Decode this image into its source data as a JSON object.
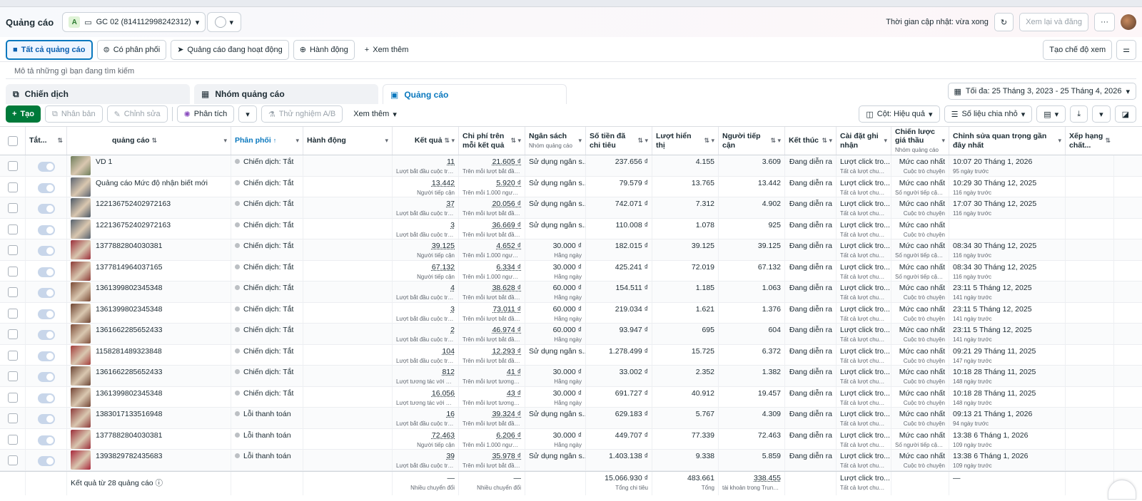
{
  "header": {
    "title": "Quảng cáo",
    "account_badge": "A",
    "account_name": "GC 02 (814112998242312)",
    "last_updated": "Thời gian cập nhật: vừa xong",
    "review_publish": "Xem lại và đăng",
    "more": "···"
  },
  "filters": {
    "all_ads": "Tất cả quảng cáo",
    "has_delivery": "Có phân phối",
    "active_ads": "Quảng cáo đang hoạt động",
    "actions": "Hành động",
    "see_more": "Xem thêm",
    "custom_view": "Tạo chế độ xem"
  },
  "search": {
    "placeholder": "Mô tả những gì bạn đang tìm kiếm"
  },
  "tabs": {
    "campaigns": "Chiến dịch",
    "adsets": "Nhóm quảng cáo",
    "ads": "Quảng cáo"
  },
  "date_range": "Tối đa: 25 Tháng 3, 2023 - 25 Tháng 4, 2026",
  "toolbar": {
    "create": "Tạo",
    "duplicate": "Nhân bản",
    "edit": "Chỉnh sửa",
    "analyze": "Phân tích",
    "ab_test": "Thử nghiệm A/B",
    "see_more": "Xem thêm",
    "columns": "Cột: Hiệu quả",
    "breakdown": "Số liệu chia nhỏ"
  },
  "columns": {
    "onoff": "Tắt...",
    "ad": "quảng cáo",
    "delivery": "Phân phối",
    "actions": "Hành động",
    "results": "Kết quả",
    "cost": "Chi phí trên mỗi kết quả",
    "budget": "Ngân sách",
    "budget_sub": "Nhóm quảng cáo",
    "spent": "Số tiền đã chi tiêu",
    "impressions": "Lượt hiển thị",
    "reach": "Người tiếp cận",
    "ends": "Kết thúc",
    "attribution": "Cài đặt ghi nhận",
    "bid": "Chiến lược giá thầu",
    "bid_sub": "Nhóm quảng cáo",
    "edited": "Chỉnh sửa quan trọng gần đây nhất",
    "rank": "Xếp hạng chất..."
  },
  "rows": [
    {
      "name": "VD 1",
      "delivery": "Chiến dịch: Tắt",
      "result": "11",
      "result_sub": "Lượt bắt đầu cuộc trò...",
      "cost": "21.605 ₫",
      "cost_sub": "Trên mỗi lượt bắt đầu...",
      "budget": "Sử dụng ngân s...",
      "budget_sub": "",
      "spent": "237.656 ₫",
      "impr": "4.155",
      "reach": "3.609",
      "ends": "Đang diễn ra",
      "attr": "Lượt click tro...",
      "attr_sub": "Tất cả lượt chuyển...",
      "bid": "Mức cao nhất",
      "bid_sub": "Cuộc trò chuyện",
      "edit": "10:07 20 Tháng 1, 2026",
      "edit_sub": "95 ngày trước",
      "thumb": "#6f7e5c"
    },
    {
      "name": "Quảng cáo Mức độ nhận biết mới",
      "delivery": "Chiến dịch: Tắt",
      "result": "13.442",
      "result_sub": "Người tiếp cận",
      "cost": "5.920 ₫",
      "cost_sub": "Trên mỗi 1.000 người...",
      "budget": "Sử dụng ngân s...",
      "budget_sub": "",
      "spent": "79.579 ₫",
      "impr": "13.765",
      "reach": "13.442",
      "ends": "Đang diễn ra",
      "attr": "Lượt click tro...",
      "attr_sub": "Tất cả lượt chuyển...",
      "bid": "Mức cao nhất",
      "bid_sub": "Số người tiếp cận h...",
      "edit": "10:29 30 Tháng 12, 2025",
      "edit_sub": "116 ngày trước",
      "thumb": "#5c6470"
    },
    {
      "name": "122136752402972163",
      "delivery": "Chiến dịch: Tắt",
      "result": "37",
      "result_sub": "Lượt bắt đầu cuộc trò...",
      "cost": "20.056 ₫",
      "cost_sub": "Trên mỗi lượt bắt đầu...",
      "budget": "Sử dụng ngân s...",
      "budget_sub": "",
      "spent": "742.071 ₫",
      "impr": "7.312",
      "reach": "4.902",
      "ends": "Đang diễn ra",
      "attr": "Lượt click tro...",
      "attr_sub": "Tất cả lượt chuyển...",
      "bid": "Mức cao nhất",
      "bid_sub": "Cuộc trò chuyện",
      "edit": "17:07 30 Tháng 12, 2025",
      "edit_sub": "116 ngày trước",
      "thumb": "#4e5a66"
    },
    {
      "name": "122136752402972163",
      "delivery": "Chiến dịch: Tắt",
      "result": "3",
      "result_sub": "Lượt bắt đầu cuộc trò...",
      "cost": "36.669 ₫",
      "cost_sub": "Trên mỗi lượt bắt đầu...",
      "budget": "Sử dụng ngân s...",
      "budget_sub": "",
      "spent": "110.008 ₫",
      "impr": "1.078",
      "reach": "925",
      "ends": "Đang diễn ra",
      "attr": "Lượt click tro...",
      "attr_sub": "Tất cả lượt chuyển...",
      "bid": "Mức cao nhất",
      "bid_sub": "Cuộc trò chuyện",
      "edit": "",
      "edit_sub": "",
      "thumb": "#56616d"
    },
    {
      "name": "1377882804030381",
      "delivery": "Chiến dịch: Tắt",
      "result": "39.125",
      "result_sub": "Người tiếp cận",
      "cost": "4.652 ₫",
      "cost_sub": "Trên mỗi 1.000 người...",
      "budget": "30.000 ₫",
      "budget_sub": "Hằng ngày",
      "spent": "182.015 ₫",
      "impr": "39.125",
      "reach": "39.125",
      "ends": "Đang diễn ra",
      "attr": "Lượt click tro...",
      "attr_sub": "Tất cả lượt chuyển...",
      "bid": "Mức cao nhất",
      "bid_sub": "Số người tiếp cận h...",
      "edit": "08:34 30 Tháng 12, 2025",
      "edit_sub": "116 ngày trước",
      "thumb": "#9b2f3a"
    },
    {
      "name": "1377814964037165",
      "delivery": "Chiến dịch: Tắt",
      "result": "67.132",
      "result_sub": "Người tiếp cận",
      "cost": "6.334 ₫",
      "cost_sub": "Trên mỗi 1.000 người...",
      "budget": "30.000 ₫",
      "budget_sub": "Hằng ngày",
      "spent": "425.241 ₫",
      "impr": "72.019",
      "reach": "67.132",
      "ends": "Đang diễn ra",
      "attr": "Lượt click tro...",
      "attr_sub": "Tất cả lượt chuyển...",
      "bid": "Mức cao nhất",
      "bid_sub": "Số người tiếp cận h...",
      "edit": "08:34 30 Tháng 12, 2025",
      "edit_sub": "116 ngày trước",
      "thumb": "#8c3a36"
    },
    {
      "name": "1361399802345348",
      "delivery": "Chiến dịch: Tắt",
      "result": "4",
      "result_sub": "Lượt bắt đầu cuộc trò...",
      "cost": "38.628 ₫",
      "cost_sub": "Trên mỗi lượt bắt đầu...",
      "budget": "60.000 ₫",
      "budget_sub": "Hằng ngày",
      "spent": "154.511 ₫",
      "impr": "1.185",
      "reach": "1.063",
      "ends": "Đang diễn ra",
      "attr": "Lượt click tro...",
      "attr_sub": "Tất cả lượt chuyển...",
      "bid": "Mức cao nhất",
      "bid_sub": "Cuộc trò chuyện",
      "edit": "23:11 5 Tháng 12, 2025",
      "edit_sub": "141 ngày trước",
      "thumb": "#7a4a35"
    },
    {
      "name": "1361399802345348",
      "delivery": "Chiến dịch: Tắt",
      "result": "3",
      "result_sub": "Lượt bắt đầu cuộc trò...",
      "cost": "73.011 ₫",
      "cost_sub": "Trên mỗi lượt bắt đầu...",
      "budget": "60.000 ₫",
      "budget_sub": "Hằng ngày",
      "spent": "219.034 ₫",
      "impr": "1.621",
      "reach": "1.376",
      "ends": "Đang diễn ra",
      "attr": "Lượt click tro...",
      "attr_sub": "Tất cả lượt chuyển...",
      "bid": "Mức cao nhất",
      "bid_sub": "Cuộc trò chuyện",
      "edit": "23:11 5 Tháng 12, 2025",
      "edit_sub": "141 ngày trước",
      "thumb": "#6e4431"
    },
    {
      "name": "1361662285652433",
      "delivery": "Chiến dịch: Tắt",
      "result": "2",
      "result_sub": "Lượt bắt đầu cuộc trò...",
      "cost": "46.974 ₫",
      "cost_sub": "Trên mỗi lượt bắt đầu...",
      "budget": "60.000 ₫",
      "budget_sub": "Hằng ngày",
      "spent": "93.947 ₫",
      "impr": "695",
      "reach": "604",
      "ends": "Đang diễn ra",
      "attr": "Lượt click tro...",
      "attr_sub": "Tất cả lượt chuyển...",
      "bid": "Mức cao nhất",
      "bid_sub": "Cuộc trò chuyện",
      "edit": "23:11 5 Tháng 12, 2025",
      "edit_sub": "141 ngày trước",
      "thumb": "#7d4d3a"
    },
    {
      "name": "1158281489323848",
      "delivery": "Chiến dịch: Tắt",
      "result": "104",
      "result_sub": "Lượt bắt đầu cuộc trò...",
      "cost": "12.293 ₫",
      "cost_sub": "Trên mỗi lượt bắt đầu...",
      "budget": "Sử dụng ngân s...",
      "budget_sub": "",
      "spent": "1.278.499 ₫",
      "impr": "15.725",
      "reach": "6.372",
      "ends": "Đang diễn ra",
      "attr": "Lượt click tro...",
      "attr_sub": "Tất cả lượt chuyển...",
      "bid": "Mức cao nhất",
      "bid_sub": "Cuộc trò chuyện",
      "edit": "09:21 29 Tháng 11, 2025",
      "edit_sub": "147 ngày trước",
      "thumb": "#a33d3b"
    },
    {
      "name": "1361662285652433",
      "delivery": "Chiến dịch: Tắt",
      "result": "812",
      "result_sub": "Lượt tương tác với bài...",
      "cost": "41 ₫",
      "cost_sub": "Trên mỗi lượt tương tá...",
      "budget": "30.000 ₫",
      "budget_sub": "Hằng ngày",
      "spent": "33.002 ₫",
      "impr": "2.352",
      "reach": "1.382",
      "ends": "Đang diễn ra",
      "attr": "Lượt click tro...",
      "attr_sub": "Tất cả lượt chuyển...",
      "bid": "Mức cao nhất",
      "bid_sub": "Cuộc trò chuyện",
      "edit": "10:18 28 Tháng 11, 2025",
      "edit_sub": "148 ngày trước",
      "thumb": "#6c4636"
    },
    {
      "name": "1361399802345348",
      "delivery": "Chiến dịch: Tắt",
      "result": "16.056",
      "result_sub": "Lượt tương tác với bài...",
      "cost": "43 ₫",
      "cost_sub": "Trên mỗi lượt tương tá...",
      "budget": "30.000 ₫",
      "budget_sub": "Hằng ngày",
      "spent": "691.727 ₫",
      "impr": "40.912",
      "reach": "19.457",
      "ends": "Đang diễn ra",
      "attr": "Lượt click tro...",
      "attr_sub": "Tất cả lượt chuyển...",
      "bid": "Mức cao nhất",
      "bid_sub": "Cuộc trò chuyện",
      "edit": "10:18 28 Tháng 11, 2025",
      "edit_sub": "148 ngày trước",
      "thumb": "#744535"
    },
    {
      "name": "1383017133516948",
      "delivery": "Lỗi thanh toán",
      "result": "16",
      "result_sub": "Lượt bắt đầu cuộc trò...",
      "cost": "39.324 ₫",
      "cost_sub": "Trên mỗi lượt bắt đầu...",
      "budget": "Sử dụng ngân s...",
      "budget_sub": "",
      "spent": "629.183 ₫",
      "impr": "5.767",
      "reach": "4.309",
      "ends": "Đang diễn ra",
      "attr": "Lượt click tro...",
      "attr_sub": "Tất cả lượt chuyển...",
      "bid": "Mức cao nhất",
      "bid_sub": "Cuộc trò chuyện",
      "edit": "09:13 21 Tháng 1, 2026",
      "edit_sub": "94 ngày trước",
      "thumb": "#8e3b3b"
    },
    {
      "name": "1377882804030381",
      "delivery": "Lỗi thanh toán",
      "result": "72.463",
      "result_sub": "Người tiếp cận",
      "cost": "6.206 ₫",
      "cost_sub": "Trên mỗi 1.000 người...",
      "budget": "30.000 ₫",
      "budget_sub": "Hằng ngày",
      "spent": "449.707 ₫",
      "impr": "77.339",
      "reach": "72.463",
      "ends": "Đang diễn ra",
      "attr": "Lượt click tro...",
      "attr_sub": "Tất cả lượt chuyển...",
      "bid": "Mức cao nhất",
      "bid_sub": "Số người tiếp cận h...",
      "edit": "13:38 6 Tháng 1, 2026",
      "edit_sub": "109 ngày trước",
      "thumb": "#9b2f3a"
    },
    {
      "name": "1393829782435683",
      "delivery": "Lỗi thanh toán",
      "result": "39",
      "result_sub": "Lượt bắt đầu cuộc trò...",
      "cost": "35.978 ₫",
      "cost_sub": "Trên mỗi lượt bắt đầu...",
      "budget": "Sử dụng ngân s...",
      "budget_sub": "",
      "spent": "1.403.138 ₫",
      "impr": "9.338",
      "reach": "5.859",
      "ends": "Đang diễn ra",
      "attr": "Lượt click tro...",
      "attr_sub": "Tất cả lượt chuyển...",
      "bid": "Mức cao nhất",
      "bid_sub": "Cuộc trò chuyện",
      "edit": "13:38 6 Tháng 1, 2026",
      "edit_sub": "109 ngày trước",
      "thumb": "#a8263a"
    }
  ],
  "footer": {
    "label": "Kết quả từ 28 quảng cáo",
    "result": "—",
    "result_sub": "Nhiều chuyển đổi",
    "cost": "—",
    "cost_sub": "Nhiều chuyển đổi",
    "spent": "15.066.930 ₫",
    "spent_sub": "Tổng chi tiêu",
    "impr": "483.661",
    "impr_sub": "Tổng",
    "reach": "338.455",
    "reach_sub": "tài khoản trong Trung ...",
    "attr": "Lượt click tro...",
    "attr_sub": "Tất cả lượt chuyển...",
    "edit": "—"
  }
}
